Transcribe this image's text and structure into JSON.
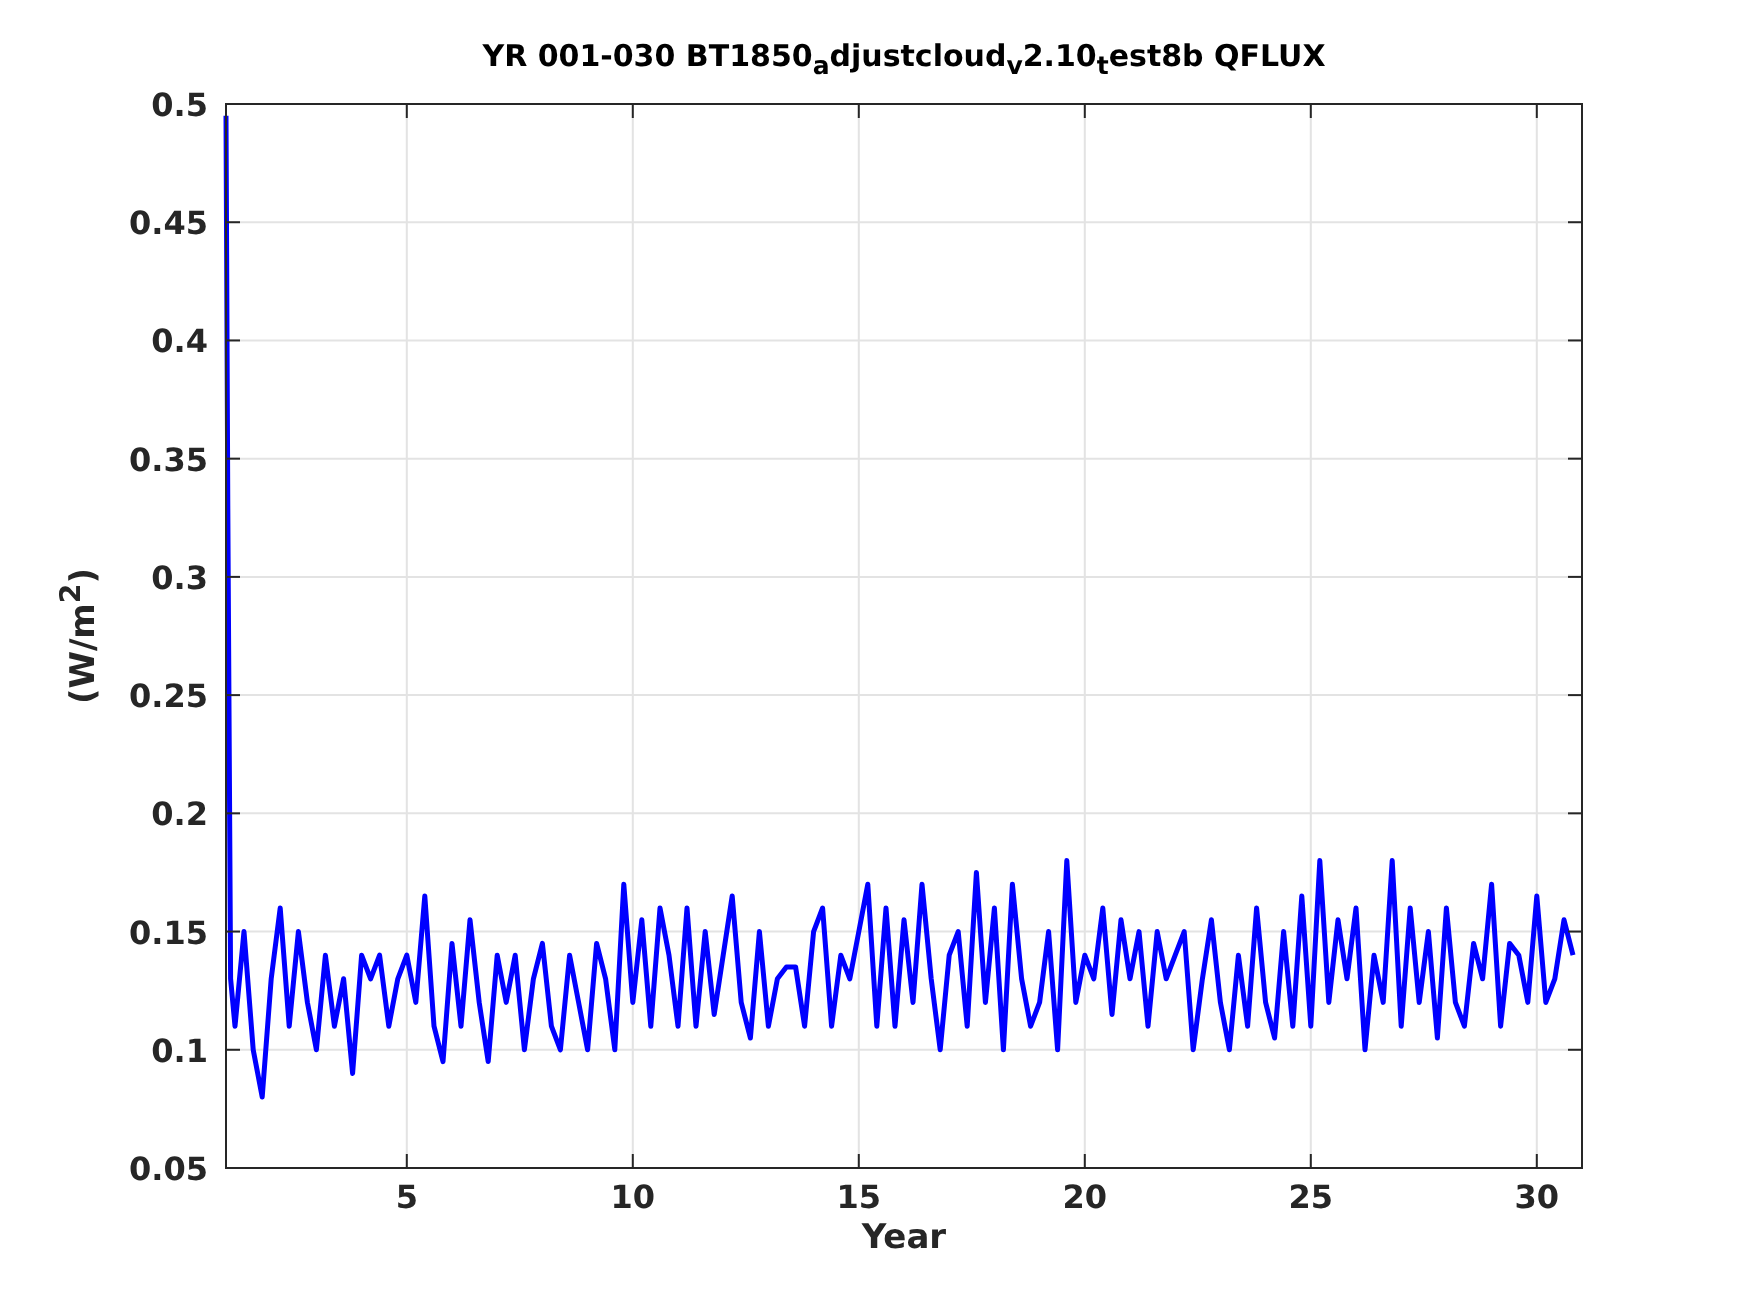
{
  "figure": {
    "chart_data": {
      "type": "line",
      "title": "YR 001-030 BT1850$_{a}$djustcloud$_{v}$2.10$_{t}$est8b QFLUX",
      "xlabel": "Year",
      "ylabel": "(W/m$^{2}$)",
      "xlim": [
        1,
        31
      ],
      "ylim": [
        0.05,
        0.5
      ],
      "xticks": [
        5,
        10,
        15,
        20,
        25,
        30
      ],
      "yticks": [
        0.05,
        0.1,
        0.15,
        0.2,
        0.25,
        0.3,
        0.35,
        0.4,
        0.45,
        0.5
      ],
      "x": [
        1,
        1.04,
        1.1,
        1.2,
        1.4,
        1.6,
        1.8,
        2,
        2.2,
        2.4,
        2.6,
        2.8,
        3,
        3.2,
        3.4,
        3.6,
        3.8,
        4,
        4.2,
        4.4,
        4.6,
        4.8,
        5,
        5.2,
        5.4,
        5.6,
        5.8,
        6,
        6.2,
        6.4,
        6.6,
        6.8,
        7,
        7.2,
        7.4,
        7.6,
        7.8,
        8,
        8.2,
        8.4,
        8.6,
        8.8,
        9,
        9.2,
        9.4,
        9.6,
        9.8,
        10,
        10.2,
        10.4,
        10.6,
        10.8,
        11,
        11.2,
        11.4,
        11.6,
        11.8,
        12,
        12.2,
        12.4,
        12.6,
        12.8,
        13,
        13.2,
        13.4,
        13.6,
        13.8,
        14,
        14.2,
        14.4,
        14.6,
        14.8,
        15,
        15.2,
        15.4,
        15.6,
        15.8,
        16,
        16.2,
        16.4,
        16.6,
        16.8,
        17,
        17.2,
        17.4,
        17.6,
        17.8,
        18,
        18.2,
        18.4,
        18.6,
        18.8,
        19,
        19.2,
        19.4,
        19.6,
        19.8,
        20,
        20.2,
        20.4,
        20.6,
        20.8,
        21,
        21.2,
        21.4,
        21.6,
        21.8,
        22,
        22.2,
        22.4,
        22.6,
        22.8,
        23,
        23.2,
        23.4,
        23.6,
        23.8,
        24,
        24.2,
        24.4,
        24.6,
        24.8,
        25,
        25.2,
        25.4,
        25.6,
        25.8,
        26,
        26.2,
        26.4,
        26.6,
        26.8,
        27,
        27.2,
        27.4,
        27.6,
        27.8,
        28,
        28.2,
        28.4,
        28.6,
        28.8,
        29,
        29.2,
        29.4,
        29.6,
        29.8,
        30,
        30.2,
        30.4,
        30.6,
        30.8
      ],
      "grid": true,
      "series": [
        {
          "color": "#0000ff",
          "values": [
            0.495,
            0.33,
            0.13,
            0.11,
            0.15,
            0.1,
            0.08,
            0.13,
            0.16,
            0.11,
            0.15,
            0.12,
            0.1,
            0.14,
            0.11,
            0.13,
            0.09,
            0.14,
            0.13,
            0.14,
            0.11,
            0.13,
            0.14,
            0.12,
            0.165,
            0.11,
            0.095,
            0.145,
            0.11,
            0.155,
            0.12,
            0.095,
            0.14,
            0.12,
            0.14,
            0.1,
            0.13,
            0.145,
            0.11,
            0.1,
            0.14,
            0.12,
            0.1,
            0.145,
            0.13,
            0.1,
            0.17,
            0.12,
            0.155,
            0.11,
            0.16,
            0.14,
            0.11,
            0.16,
            0.11,
            0.15,
            0.115,
            0.14,
            0.165,
            0.12,
            0.105,
            0.15,
            0.11,
            0.13,
            0.135,
            0.135,
            0.11,
            0.15,
            0.16,
            0.11,
            0.14,
            0.13,
            0.15,
            0.17,
            0.11,
            0.16,
            0.11,
            0.155,
            0.12,
            0.17,
            0.13,
            0.1,
            0.14,
            0.15,
            0.11,
            0.175,
            0.12,
            0.16,
            0.1,
            0.17,
            0.13,
            0.11,
            0.12,
            0.15,
            0.1,
            0.18,
            0.12,
            0.14,
            0.13,
            0.16,
            0.115,
            0.155,
            0.13,
            0.15,
            0.11,
            0.15,
            0.13,
            0.14,
            0.15,
            0.1,
            0.13,
            0.155,
            0.12,
            0.1,
            0.14,
            0.11,
            0.16,
            0.12,
            0.105,
            0.15,
            0.11,
            0.165,
            0.11,
            0.18,
            0.12,
            0.155,
            0.13,
            0.16,
            0.1,
            0.14,
            0.12,
            0.18,
            0.11,
            0.16,
            0.12,
            0.15,
            0.105,
            0.16,
            0.12,
            0.11,
            0.145,
            0.13,
            0.17,
            0.11,
            0.145,
            0.14,
            0.12,
            0.165,
            0.12,
            0.13,
            0.155,
            0.14
          ]
        }
      ]
    }
  }
}
